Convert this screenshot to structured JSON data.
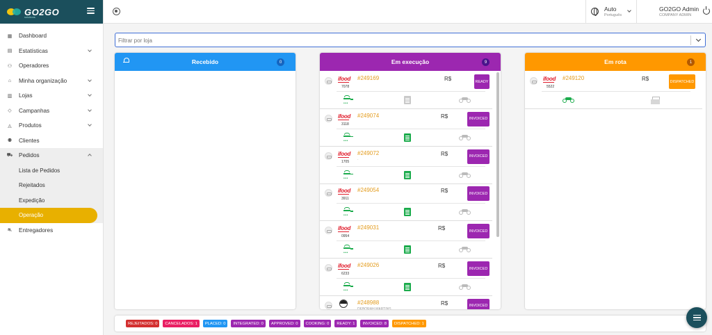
{
  "brand": {
    "logo_text": "GO2GO",
    "logo_sub": "solutions"
  },
  "sidebar": {
    "items": [
      {
        "label": "Dashboard",
        "icon": "dashboard-icon",
        "glyph": "▦",
        "chevron": false
      },
      {
        "label": "Estatísticas",
        "icon": "chart-icon",
        "glyph": "▤",
        "chevron": true
      },
      {
        "label": "Operadores",
        "icon": "user-icon",
        "glyph": "⚇",
        "chevron": false
      },
      {
        "label": "Minha organização",
        "icon": "bank-icon",
        "glyph": "⌂",
        "chevron": true
      },
      {
        "label": "Lojas",
        "icon": "store-icon",
        "glyph": "▥",
        "chevron": true
      },
      {
        "label": "Campanhas",
        "icon": "tag-icon",
        "glyph": "◇",
        "chevron": true
      },
      {
        "label": "Produtos",
        "icon": "products-icon",
        "glyph": "◬",
        "chevron": true
      },
      {
        "label": "Clientes",
        "icon": "users-icon",
        "glyph": "⚉",
        "chevron": false
      }
    ],
    "pedidos": {
      "label": "Pedidos",
      "sub": [
        "Lista de Pedidos",
        "Rejeitados",
        "Expedição",
        "Operação"
      ],
      "active": "Operação"
    },
    "entregadores": "Entregadores"
  },
  "topbar": {
    "lang_main": "Auto",
    "lang_sub": "Português",
    "user_name": "GO2GO Admin",
    "user_role": "COMPANY ADMIN"
  },
  "filter": {
    "placeholder": "Filtrar por loja",
    "value": ""
  },
  "columns": [
    {
      "title": "Recebido",
      "count": "0",
      "color": "#2196f3",
      "count_bg": "#1565c0"
    },
    {
      "title": "Em execução",
      "count": "9",
      "color": "#9c27b0",
      "count_bg": "#4a148c"
    },
    {
      "title": "Em rota",
      "count": "1",
      "color": "#ff9800",
      "count_bg": "#b35900"
    }
  ],
  "exec_orders": [
    {
      "source": "ifood",
      "short": "7078",
      "order": "#249169",
      "customer": "",
      "currency": "R$",
      "status": "READY",
      "doc": "grey"
    },
    {
      "source": "ifood",
      "short": "3118",
      "order": "#249074",
      "customer": "",
      "currency": "R$",
      "status": "INVOICED",
      "doc": "green"
    },
    {
      "source": "ifood",
      "short": "1705",
      "order": "#249072",
      "customer": "·",
      "currency": "R$",
      "status": "INVOICED",
      "doc": "green"
    },
    {
      "source": "ifood",
      "short": "3911",
      "order": "#249054",
      "customer": "",
      "currency": "R$",
      "status": "INVOICED",
      "doc": "green"
    },
    {
      "source": "ifood",
      "short": "0954",
      "order": "#249031",
      "customer": "",
      "currency": "R$",
      "status": "INVOICED",
      "doc": "green"
    },
    {
      "source": "ifood",
      "short": "6233",
      "order": "#249026",
      "customer": "",
      "currency": "R$",
      "status": "INVOICED",
      "doc": "green"
    },
    {
      "source": "avatar",
      "short": "",
      "order": "#248988",
      "customer": "DEBORAH MARTINS",
      "currency": "R$",
      "status": "INVOICED",
      "doc": "green"
    }
  ],
  "route_orders": [
    {
      "source": "ifood",
      "short": "5522",
      "order": "#249120",
      "customer": "",
      "currency": "R$",
      "status": "DISPATCHED"
    }
  ],
  "status_colors": {
    "READY": "#9c27b0",
    "INVOICED": "#9c27b0",
    "DISPATCHED": "#ff9800"
  },
  "footer_chips": [
    {
      "label": "REJEITADOS: 0",
      "color": "#d32f2f"
    },
    {
      "label": "CANCELADOS: 1",
      "color": "#e91e63"
    },
    {
      "label": "PLACED: 0",
      "color": "#2196f3"
    },
    {
      "label": "INTEGRATED: 0",
      "color": "#9c27b0"
    },
    {
      "label": "APPROVED: 0",
      "color": "#9c27b0"
    },
    {
      "label": "COOKING: 0",
      "color": "#9c27b0"
    },
    {
      "label": "READY: 1",
      "color": "#9c27b0"
    },
    {
      "label": "INVOICED: 8",
      "color": "#9c27b0"
    },
    {
      "label": "DISPATCHED: 1",
      "color": "#ff9800"
    }
  ]
}
